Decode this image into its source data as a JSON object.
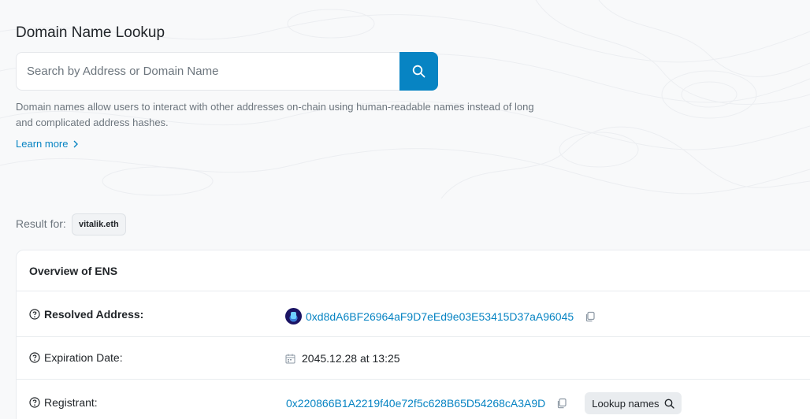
{
  "page": {
    "title": "Domain Name Lookup",
    "search": {
      "placeholder": "Search by Address or Domain Name",
      "value": "",
      "button_icon": "search-icon"
    },
    "description": "Domain names allow users to interact with other addresses on-chain using human-readable names instead of long and complicated address hashes.",
    "learn_more": "Learn more",
    "accent_color": "#0784c3"
  },
  "result": {
    "label": "Result for:",
    "query": "vitalik.eth"
  },
  "overview": {
    "title": "Overview of ENS",
    "rows": {
      "resolved_address": {
        "label": "Resolved Address:",
        "value": "0xd8dA6BF26964aF9D7eEd9e03E53415D37aA96045",
        "icon": "avatar"
      },
      "expiration_date": {
        "label": "Expiration Date:",
        "value": "2045.12.28 at 13:25",
        "icon": "calendar-icon"
      },
      "registrant": {
        "label": "Registrant:",
        "value": "0x220866B1A2219f40e72f5c628B65D54268cA3A9D",
        "lookup_button": "Lookup names"
      }
    }
  }
}
